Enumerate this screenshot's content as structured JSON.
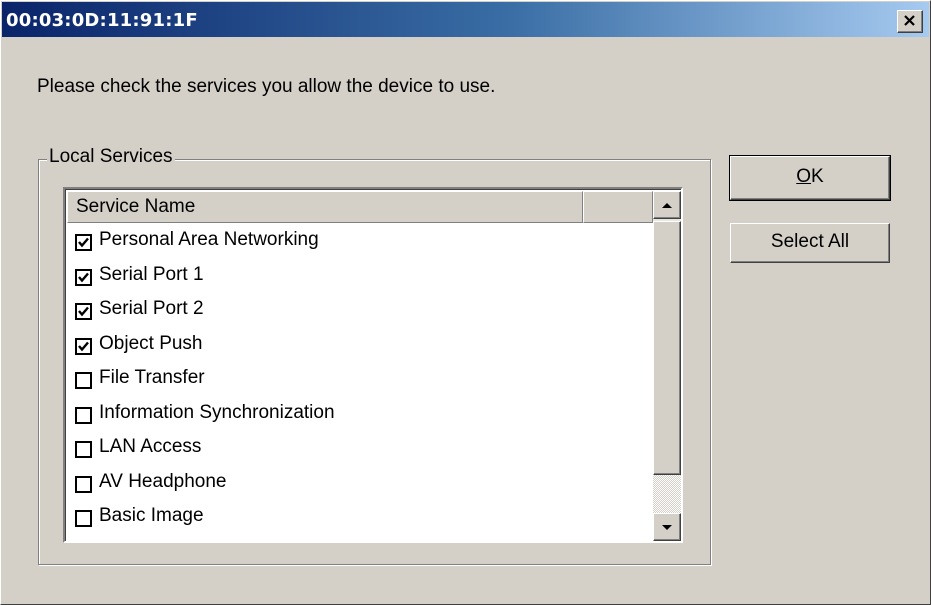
{
  "window": {
    "title": "00:03:0D:11:91:1F",
    "close_icon": "close-x-icon"
  },
  "prompt_text": "Please check the services you allow the device to use.",
  "group": {
    "label": "Local Services"
  },
  "list": {
    "column_header": "Service Name",
    "items": [
      {
        "label": "Personal Area Networking",
        "checked": true
      },
      {
        "label": "Serial Port 1",
        "checked": true
      },
      {
        "label": "Serial Port 2",
        "checked": true
      },
      {
        "label": "Object Push",
        "checked": true
      },
      {
        "label": "File Transfer",
        "checked": false
      },
      {
        "label": "Information Synchronization",
        "checked": false
      },
      {
        "label": "LAN Access",
        "checked": false
      },
      {
        "label": "AV Headphone",
        "checked": false
      },
      {
        "label": "Basic Image",
        "checked": false
      }
    ]
  },
  "buttons": {
    "ok_mnemonic": "O",
    "ok_rest": "K",
    "select_all": "Select All"
  }
}
